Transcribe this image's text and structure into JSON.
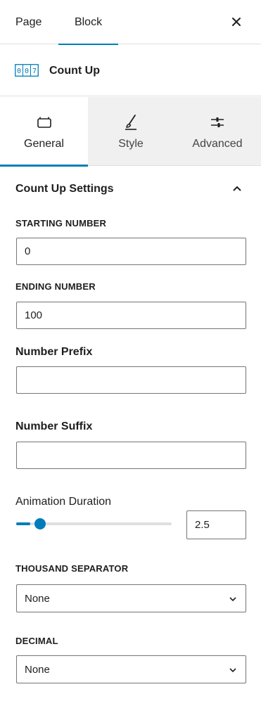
{
  "top_tabs": {
    "page": "Page",
    "block": "Block",
    "close_icon": "close-icon"
  },
  "block": {
    "icon": "count-up-icon",
    "icon_digits": [
      "0",
      "0",
      "7"
    ],
    "title": "Count Up"
  },
  "inspector_tabs": [
    {
      "label": "General",
      "icon": "briefcase-icon",
      "active": true
    },
    {
      "label": "Style",
      "icon": "brush-icon",
      "active": false
    },
    {
      "label": "Advanced",
      "icon": "sliders-icon",
      "active": false
    }
  ],
  "panel": {
    "title": "Count Up Settings",
    "starting_number": {
      "label": "STARTING NUMBER",
      "value": "0"
    },
    "ending_number": {
      "label": "ENDING NUMBER",
      "value": "100"
    },
    "number_prefix": {
      "label": "Number Prefix",
      "value": ""
    },
    "number_suffix": {
      "label": "Number Suffix",
      "value": ""
    },
    "animation_duration": {
      "label": "Animation Duration",
      "value": "2.5",
      "fill_fraction": 0.09
    },
    "thousand_separator": {
      "label": "THOUSAND SEPARATOR",
      "value": "None"
    },
    "decimal": {
      "label": "DECIMAL",
      "value": "None"
    }
  },
  "colors": {
    "accent": "#007cba",
    "border": "#757575",
    "divider": "#e0e0e0",
    "tab_bg": "#f0f0f0",
    "text": "#1e1e1e"
  }
}
